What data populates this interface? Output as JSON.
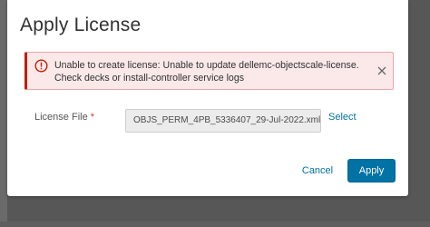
{
  "dialog": {
    "title": "Apply License"
  },
  "alert": {
    "type": "error",
    "icon": "error-circle-icon",
    "message": "Unable to create license: Unable to update dellemc-objectscale-license. Check decks or install-controller service logs",
    "close_icon": "close-icon",
    "accent_color": "#c21d00"
  },
  "form": {
    "license_file": {
      "label": "License File",
      "required_marker": "*",
      "value": "OBJS_PERM_4PB_5336407_29-Jul-2022.xml",
      "select_label": "Select"
    }
  },
  "footer": {
    "cancel_label": "Cancel",
    "apply_label": "Apply",
    "primary_color": "#0072a3"
  }
}
